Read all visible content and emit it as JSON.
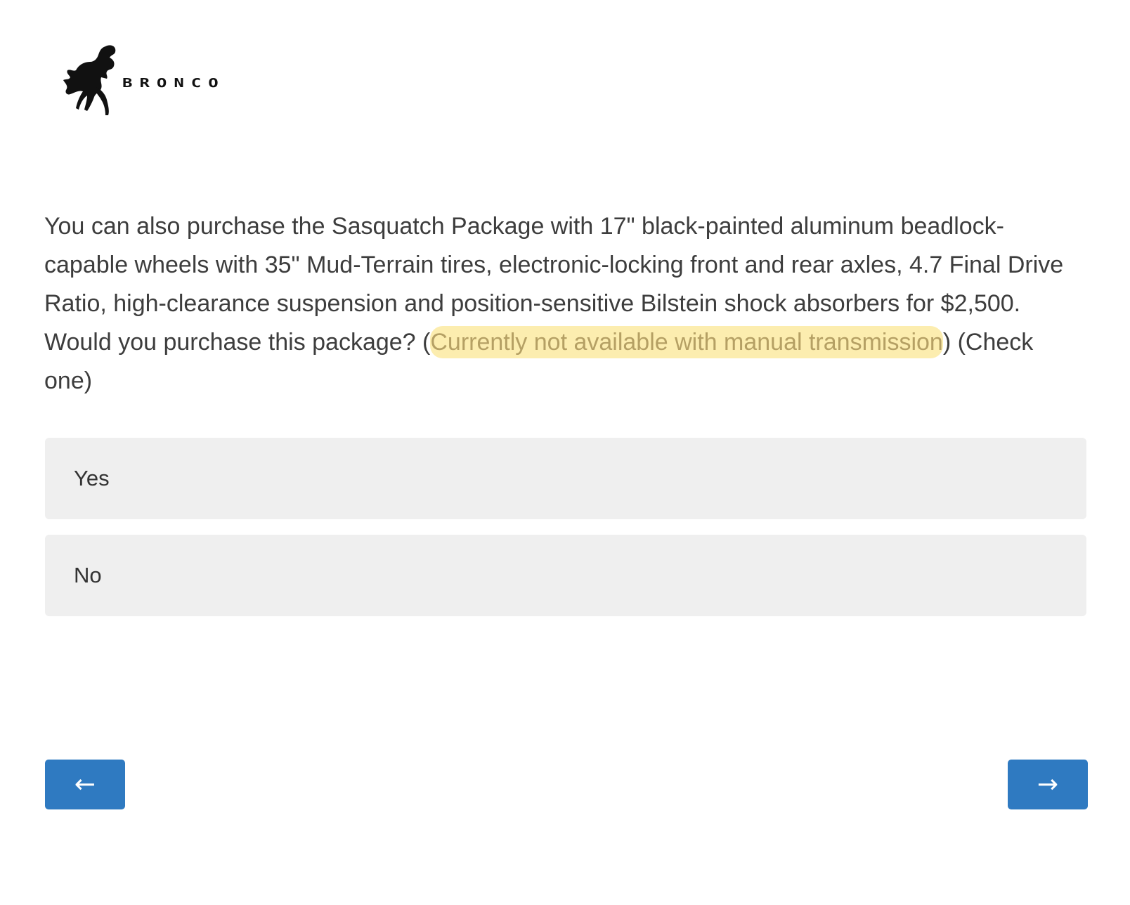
{
  "logo": {
    "wordmark": "BRONCO",
    "mark_icon": "bucking-horse-icon"
  },
  "question": {
    "text_before": "You can also purchase the Sasquatch Package with 17\" black-painted aluminum beadlock-capable wheels with 35\" Mud-Terrain tires, electronic-locking front and rear axles, 4.7 Final Drive Ratio, high-clearance suspension and position-sensitive Bilstein shock absorbers for $2,500.  Would you purchase this package?  (",
    "highlighted": "Currently not available with manual transmission",
    "text_after": ") (Check one)"
  },
  "choices": [
    {
      "label": "Yes"
    },
    {
      "label": "No"
    }
  ],
  "nav": {
    "back_label": "←",
    "next_label": "→"
  },
  "colors": {
    "button_blue": "#2f7ac1",
    "choice_bg": "#efefef",
    "highlight": "#fade6e"
  }
}
